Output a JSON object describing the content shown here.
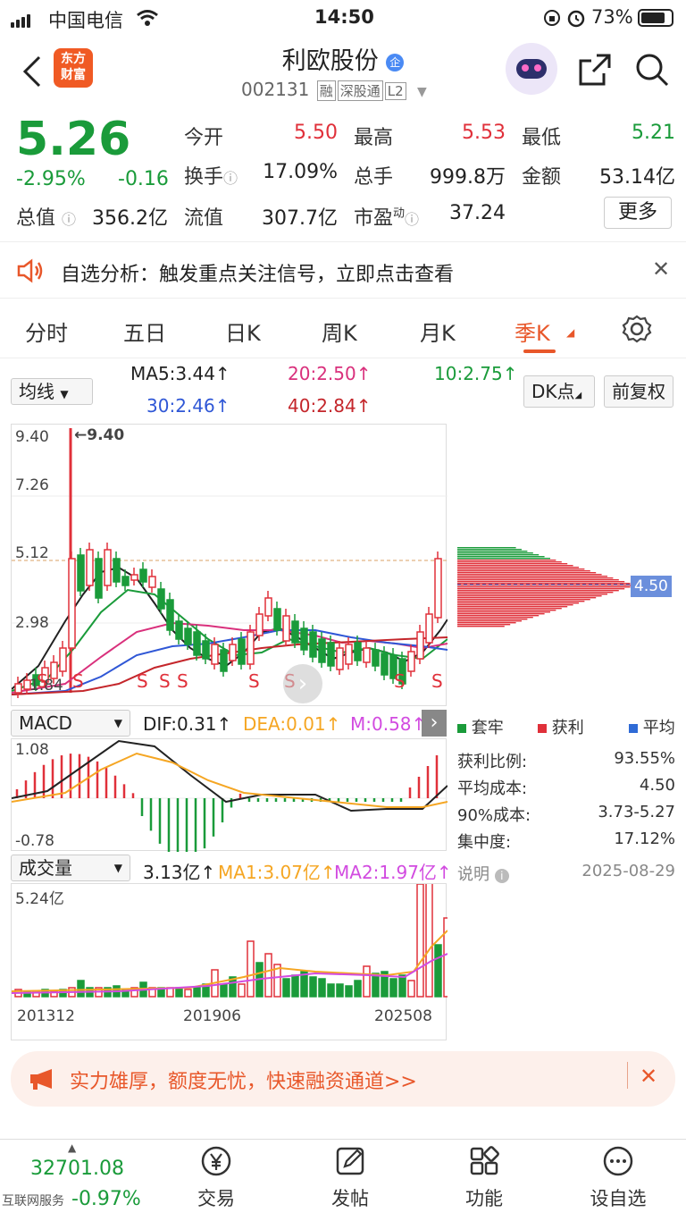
{
  "status_bar": {
    "carrier": "中国电信",
    "time": "14:50",
    "battery": "73%"
  },
  "header": {
    "logo_line1": "东方",
    "logo_line2": "财富",
    "title": "利欧股份",
    "title_badge": "企",
    "code": "002131",
    "tags": [
      "融",
      "深股通",
      "L2"
    ]
  },
  "quote": {
    "price": "5.26",
    "change_pct": "-2.95%",
    "change": "-0.16",
    "open_label": "今开",
    "open": "5.50",
    "high_label": "最高",
    "high": "5.53",
    "low_label": "最低",
    "low": "5.21",
    "turnover_label": "换手",
    "turnover": "17.09%",
    "volume_label": "总手",
    "volume": "999.8万",
    "amount_label": "金额",
    "amount": "53.14亿",
    "mktcap_label": "总值",
    "mktcap": "356.2亿",
    "float_label": "流值",
    "float": "307.7亿",
    "pe_label": "市盈",
    "pe_sup": "动",
    "pe": "37.24",
    "more_label": "更多"
  },
  "alert": {
    "text": "自选分析：触发重点关注信号，立即点击查看"
  },
  "tabs": [
    "分时",
    "五日",
    "日K",
    "周K",
    "月K",
    "季K"
  ],
  "active_tab": "季K",
  "ma_legend": {
    "dropdown": "均线",
    "ma5": "MA5:3.44↑",
    "ma10": "10:2.75↑",
    "ma20": "20:2.50↑",
    "ma30": "30:2.46↑",
    "ma40": "40:2.84↑",
    "dk_button": "DK点",
    "adjust_button": "前复权"
  },
  "chart": {
    "y_labels": [
      "9.40",
      "7.26",
      "5.12",
      "2.98"
    ],
    "max_marker": "←9.40",
    "min_marker": "1.84",
    "profile_price": "4.50"
  },
  "macd": {
    "dropdown": "MACD",
    "dif": "DIF:0.31↑",
    "dea": "DEA:0.01↑",
    "m": "M:0.58↑",
    "y_top": "1.08",
    "y_bottom": "-0.78"
  },
  "volume": {
    "dropdown": "成交量",
    "value": "3.13亿↑",
    "ma1": "MA1:3.07亿↑",
    "ma2": "MA2:1.97亿↑",
    "y_top": "5.24亿",
    "x_labels": [
      "201312",
      "201906",
      "202508"
    ]
  },
  "chip": {
    "legend": [
      "套牢",
      "获利",
      "平均"
    ],
    "rows": [
      {
        "label": "获利比例:",
        "value": "93.55%"
      },
      {
        "label": "平均成本:",
        "value": "4.50"
      },
      {
        "label": "90%成本:",
        "value": "3.73-5.27"
      },
      {
        "label": "集中度:",
        "value": "17.12%"
      }
    ],
    "note_label": "说明",
    "date": "2025-08-29"
  },
  "ad": {
    "text": "实力雄厚，额度无忧，快速融资通道>>"
  },
  "bottom": {
    "index_value": "32701.08",
    "index_change": "-0.97%",
    "service": "互联网服务",
    "nav": [
      "交易",
      "发帖",
      "功能",
      "设自选"
    ]
  },
  "colors": {
    "up": "#e0303a",
    "down": "#1a9b3a",
    "accent": "#e8572a"
  }
}
